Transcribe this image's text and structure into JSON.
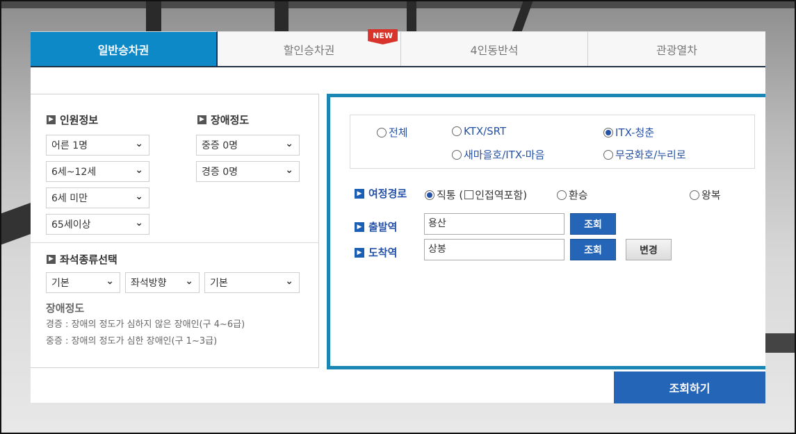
{
  "tabs": [
    {
      "label": "일반승차권",
      "active": true
    },
    {
      "label": "할인승차권",
      "badge": "NEW"
    },
    {
      "label": "4인동반석"
    },
    {
      "label": "관광열차"
    }
  ],
  "passenger": {
    "title": "인원정보",
    "selects": [
      "어른 1명",
      "6세~12세",
      "6세 미만",
      "65세이상"
    ]
  },
  "disability": {
    "title": "장애정도",
    "selects": [
      "중증 0명",
      "경증 0명"
    ]
  },
  "seat": {
    "title": "좌석종류선택",
    "selects": [
      "기본",
      "좌석방향",
      "기본"
    ]
  },
  "notes": {
    "title": "장애정도",
    "lines": [
      "경증 : 장애의 정도가 심하지 않은 장애인(구 4~6급)",
      "중증 : 장애의 정도가 심한 장애인(구 1~3급)"
    ]
  },
  "trains": {
    "all": "전체",
    "ktx": "KTX/SRT",
    "itx": "ITX-청춘",
    "saemaul": "새마을호/ITX-마음",
    "mugunghwa": "무궁화호/누리로",
    "selected": "itx"
  },
  "route": {
    "title": "여정경로",
    "direct": "직통 (",
    "nearby": "인접역포함)",
    "transfer": "환승",
    "roundtrip": "왕복"
  },
  "departure": {
    "label": "출발역",
    "value": "용산",
    "search": "조회"
  },
  "arrival": {
    "label": "도착역",
    "value": "상봉",
    "search": "조회",
    "swap": "변경"
  },
  "submit": "조회하기",
  "colors": {
    "accent": "#0d89c8",
    "button": "#2565b8",
    "badge": "#d9342b"
  }
}
